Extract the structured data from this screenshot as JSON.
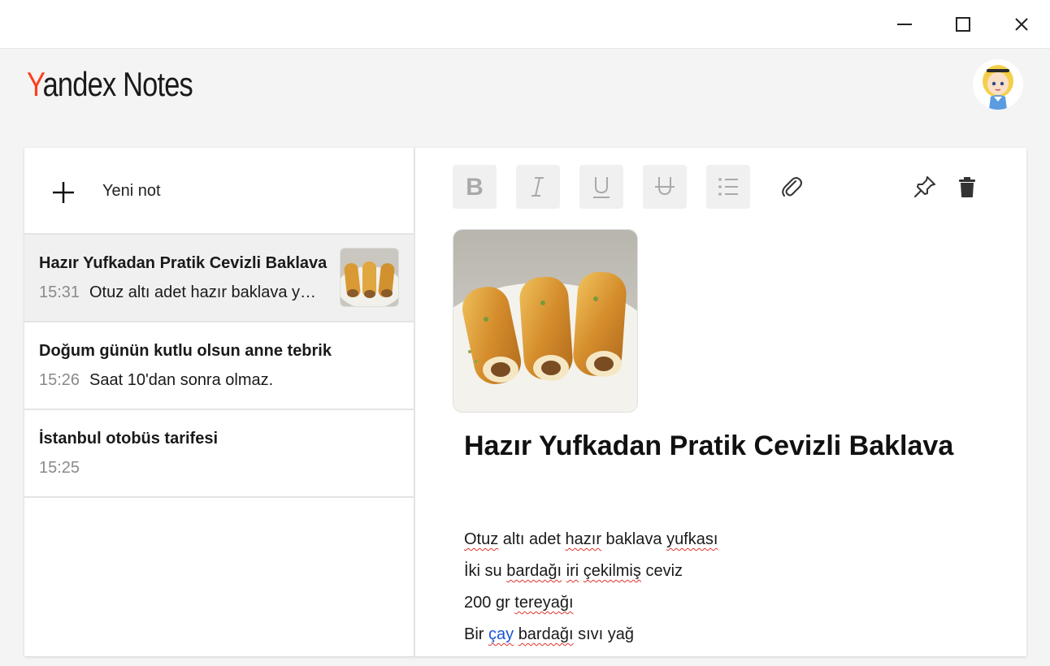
{
  "app": {
    "logo_first": "Y",
    "logo_rest": "andex Notes"
  },
  "toolbar": {
    "bold": "bold-icon",
    "italic": "italic-icon",
    "underline": "underline-icon",
    "strike": "strikethrough-icon",
    "list": "list-icon",
    "attach": "paperclip-icon",
    "pin": "pin-icon",
    "delete": "trash-icon"
  },
  "sidebar": {
    "new_note_label": "Yeni not",
    "notes": [
      {
        "title": "Hazır Yufkadan Pratik Cevizli Baklava",
        "time": "15:31",
        "preview": "Otuz altı adet hazır baklava yufkası",
        "active": true
      },
      {
        "title": "Doğum günün kutlu olsun anne tebrik",
        "time": "15:26",
        "preview": "Saat 10'dan sonra olmaz."
      },
      {
        "title": "İstanbul otobüs tarifesi",
        "time": "15:25",
        "preview": ""
      }
    ]
  },
  "editor": {
    "title": "Hazır Yufkadan Pratik Cevizli Baklava",
    "lines": [
      [
        "Otuz",
        " altı adet ",
        "hazır",
        " baklava ",
        "yufkası"
      ],
      [
        "İki su ",
        "bardağı",
        " ",
        "iri",
        " ",
        "çekilmiş",
        " ceviz"
      ],
      [
        "200 gr ",
        "tereyağı"
      ],
      [
        "Bir ",
        "çay",
        " ",
        "bardağı",
        " sıvı yağ"
      ]
    ]
  },
  "colors": {
    "accent": "#fc3f1d",
    "active_note_bg": "#f0f0f0",
    "spell_underline": "#e0332e",
    "link": "#1a55d6"
  }
}
